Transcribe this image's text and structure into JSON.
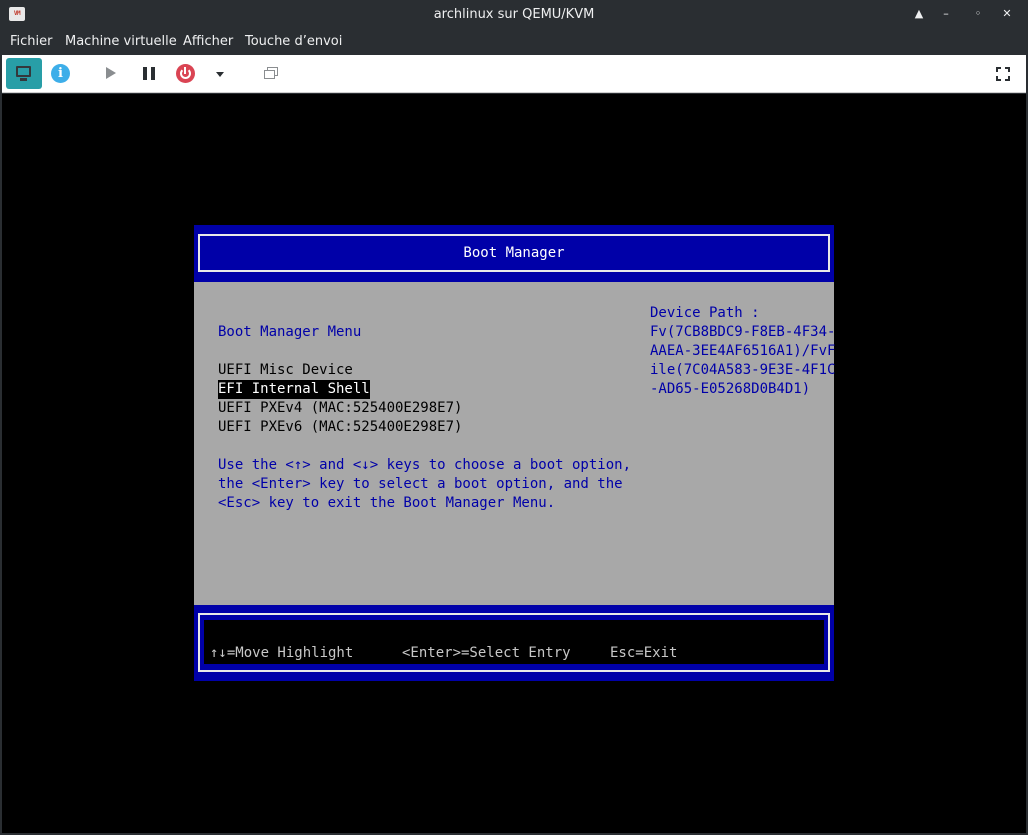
{
  "window": {
    "title": "archlinux sur QEMU/KVM",
    "app_icon_text": "VM",
    "controls": [
      "▲",
      "–",
      "◦",
      "✕"
    ]
  },
  "menubar": {
    "items": [
      "Fichier",
      "Machine virtuelle",
      "Afficher",
      "Touche d’envoi"
    ]
  },
  "toolbar": {
    "buttons": [
      "console-icon",
      "info-icon",
      "play-icon",
      "pause-icon",
      "power-icon",
      "dropdown-icon",
      "snapshot-icon",
      "fullscreen-icon"
    ],
    "info_glyph": "i"
  },
  "boot_manager": {
    "header_title": "Boot Manager",
    "menu_title": "Boot Manager Menu",
    "options": [
      {
        "label": "UEFI Misc Device",
        "selected": false
      },
      {
        "label": "EFI Internal Shell",
        "selected": true
      },
      {
        "label": "UEFI PXEv4 (MAC:525400E298E7)",
        "selected": false
      },
      {
        "label": "UEFI PXEv6 (MAC:525400E298E7)",
        "selected": false
      }
    ],
    "help_lines": [
      "Use the <↑> and <↓> keys to choose a boot option,",
      "the <Enter> key to select a boot option, and the",
      "<Esc> key to exit the Boot Manager Menu."
    ],
    "device_path_label": "Device Path :",
    "device_path_lines": [
      "Fv(7CB8BDC9-F8EB-4F34-",
      "AAEA-3EE4AF6516A1)/FvF",
      "ile(7C04A583-9E3E-4F1C",
      "-AD65-E05268D0B4D1)"
    ],
    "footer": {
      "move": "↑↓=Move Highlight",
      "select": "<Enter>=Select Entry",
      "exit": "Esc=Exit"
    }
  },
  "colors": {
    "bios_blue": "#0000a8",
    "bios_gray": "#a8a8a8",
    "accent_teal": "#1d99a3",
    "power_red": "#da4453"
  }
}
